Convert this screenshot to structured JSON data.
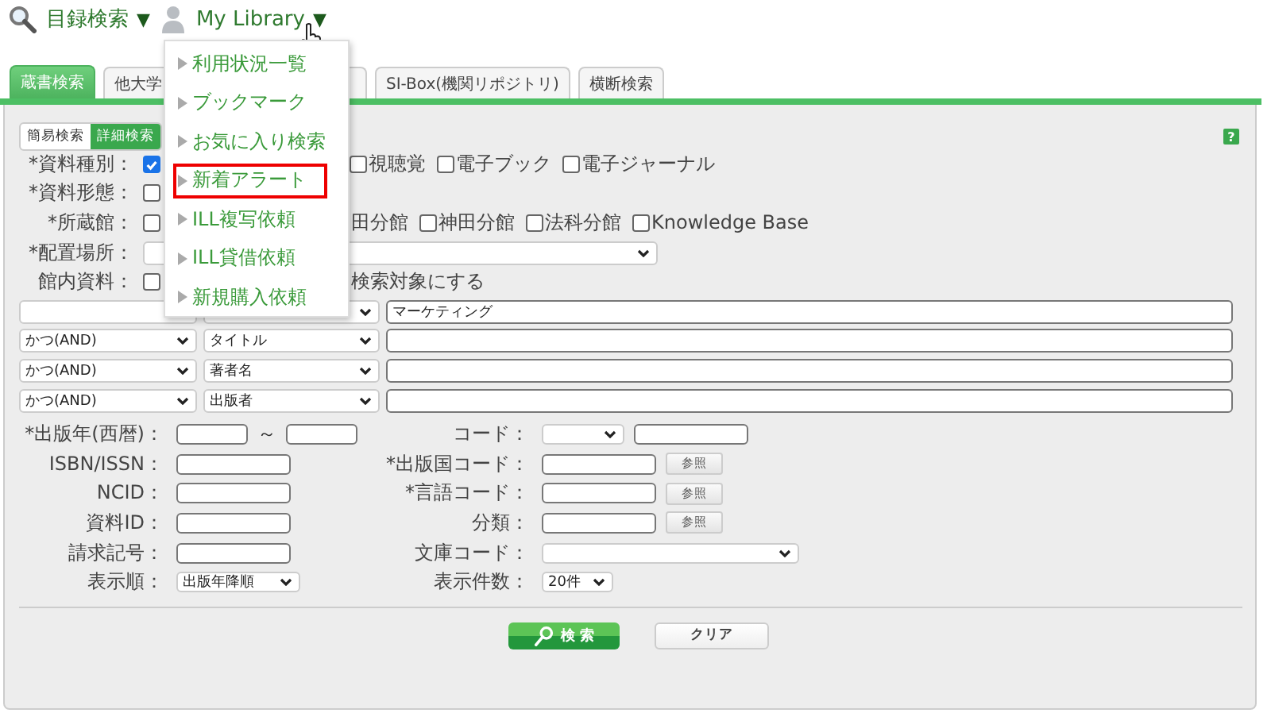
{
  "nav": [
    {
      "kind": "search",
      "label": "目録検索",
      "caret": "▼"
    },
    {
      "kind": "user",
      "label": "My Library",
      "caret": "▼"
    }
  ],
  "menu": {
    "items": [
      {
        "label": "利用状況一覧",
        "highlighted": false
      },
      {
        "label": "ブックマーク",
        "highlighted": false
      },
      {
        "label": "お気に入り検索",
        "highlighted": false
      },
      {
        "label": "新着アラート",
        "highlighted": true
      },
      {
        "label": "ILL複写依頼",
        "highlighted": false
      },
      {
        "label": "ILL貸借依頼",
        "highlighted": false
      },
      {
        "label": "新規購入依頼",
        "highlighted": false
      }
    ]
  },
  "tabs": [
    {
      "label": "蔵書検索",
      "selected": true
    },
    {
      "label": "他大学",
      "selected": false
    },
    {
      "label": "SI-Box(機関リポジトリ)",
      "selected": false
    },
    {
      "label": "横断検索",
      "selected": false
    }
  ],
  "mode_toggle": [
    {
      "label": "簡易検索",
      "selected": false
    },
    {
      "label": "詳細検索",
      "selected": true
    }
  ],
  "help": "?",
  "criteria": [
    {
      "label": "*資料種別：",
      "kind": "checks",
      "first": {
        "checked": true
      },
      "options": [
        {
          "kind": "checkbox",
          "label": "視聴覚",
          "checked": false
        },
        {
          "kind": "checkbox",
          "label": "電子ブック",
          "checked": false
        },
        {
          "kind": "checkbox",
          "label": "電子ジャーナル",
          "checked": false
        }
      ]
    },
    {
      "label": "*資料形態：",
      "kind": "checks",
      "first": {
        "checked": false
      }
    },
    {
      "label": "*所蔵館：",
      "kind": "checks",
      "first": {
        "checked": false
      },
      "options": [
        {
          "kind": "text",
          "label": "田分館"
        },
        {
          "kind": "checkbox",
          "label": "神田分館",
          "checked": false
        },
        {
          "kind": "checkbox",
          "label": "法科分館",
          "checked": false
        },
        {
          "kind": "checkbox",
          "label": "Knowledge Base",
          "checked": false
        }
      ]
    },
    {
      "label": "*配置場所：",
      "kind": "select"
    },
    {
      "label": "館内資料：",
      "kind": "checks",
      "first": {
        "checked": false
      },
      "options": [
        {
          "kind": "text",
          "label": "検索対象にする"
        }
      ]
    }
  ],
  "search_rows": [
    {
      "value": "マーケティング"
    },
    {
      "operator": "かつ(AND)",
      "field": "タイトル"
    },
    {
      "operator": "かつ(AND)",
      "field": "著者名"
    },
    {
      "operator": "かつ(AND)",
      "field": "出版者"
    }
  ],
  "fields_left": [
    {
      "label": "*出版年(西暦)：",
      "kind": "range",
      "separator": "～"
    },
    {
      "label": "ISBN/ISSN：",
      "kind": "text"
    },
    {
      "label": "NCID：",
      "kind": "text"
    },
    {
      "label": "資料ID：",
      "kind": "text"
    },
    {
      "label": "請求記号：",
      "kind": "text"
    },
    {
      "label": "表示順：",
      "kind": "select",
      "value": "出版年降順"
    }
  ],
  "fields_right": [
    {
      "label": "コード：",
      "kind": "select_text"
    },
    {
      "label": "*出版国コード：",
      "kind": "lookup",
      "button": "参照"
    },
    {
      "label": "*言語コード：",
      "kind": "lookup",
      "button": "参照"
    },
    {
      "label": "分類：",
      "kind": "lookup",
      "button": "参照"
    },
    {
      "label": "文庫コード：",
      "kind": "select_wide"
    },
    {
      "label": "表示件数：",
      "kind": "select",
      "value": "20件"
    }
  ],
  "buttons": [
    {
      "kind": "search",
      "label": "検 索"
    },
    {
      "kind": "clear",
      "label": "クリア"
    }
  ]
}
